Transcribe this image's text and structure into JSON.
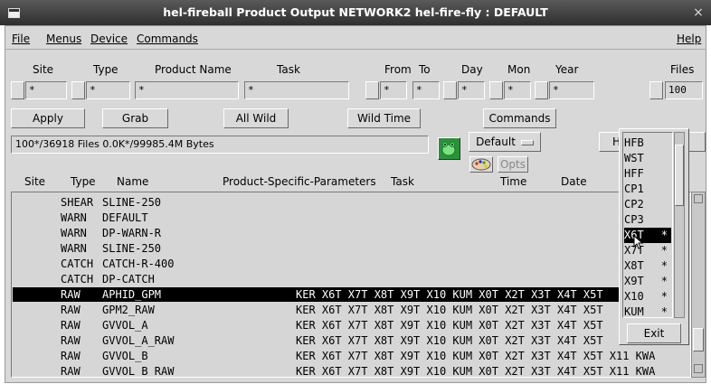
{
  "window": {
    "title": "hel-fireball   Product Output NETWORK2 hel-fire-fly : DEFAULT",
    "close_glyph": "×"
  },
  "menu": {
    "file": "File",
    "menus": "Menus",
    "device": "Device",
    "commands": "Commands",
    "help": "Help"
  },
  "filters": {
    "labels": {
      "site": "Site",
      "type": "Type",
      "product_name": "Product Name",
      "task": "Task",
      "from": "From",
      "to": "To",
      "day": "Day",
      "mon": "Mon",
      "year": "Year",
      "files": "Files"
    },
    "values": {
      "site": "*",
      "type": "*",
      "product_name": "*",
      "task": "*",
      "from": "*",
      "to": "*",
      "day": "*",
      "mon": "*",
      "year": "*",
      "files": "100"
    }
  },
  "buttons": {
    "apply": "Apply",
    "grab": "Grab",
    "all_wild": "All Wild",
    "wild_time": "Wild Time",
    "commands": "Commands",
    "default": "Default",
    "opts": "Opts",
    "he": "He",
    "exit": "Exit"
  },
  "status": "100*/36918 Files  0.0K*/99985.4M Bytes",
  "columns": {
    "site": "Site",
    "type": "Type",
    "name": "Name",
    "params": "Product-Specific-Parameters",
    "task": "Task",
    "time": "Time",
    "date": "Date"
  },
  "rows": [
    {
      "type": "SHEAR",
      "name": "SLINE-250",
      "params": ""
    },
    {
      "type": "WARN",
      "name": "DEFAULT",
      "params": ""
    },
    {
      "type": "WARN",
      "name": "DP-WARN-R",
      "params": ""
    },
    {
      "type": "WARN",
      "name": "SLINE-250",
      "params": ""
    },
    {
      "type": "CATCH",
      "name": "CATCH-R-400",
      "params": ""
    },
    {
      "type": "CATCH",
      "name": "DP-CATCH",
      "params": ""
    },
    {
      "type": "RAW",
      "name": "APHID_GPM",
      "params": "KER X6T X7T X8T X9T X10 KUM X0T X2T X3T X4T X5T",
      "selected": true
    },
    {
      "type": "RAW",
      "name": "GPM2_RAW",
      "params": "KER X6T X7T X8T X9T X10 KUM X0T X2T X3T X4T X5T"
    },
    {
      "type": "RAW",
      "name": "GVVOL_A",
      "params": "KER X6T X7T X8T X9T X10 KUM X0T X2T X3T X4T X5T"
    },
    {
      "type": "RAW",
      "name": "GVVOL_A_RAW",
      "params": "KER X6T X7T X8T X9T X10 KUM X0T X2T X3T X4T X5T"
    },
    {
      "type": "RAW",
      "name": "GVVOL_B",
      "params": "KER X6T X7T X8T X9T X10 KUM X0T X2T X3T X4T X5T X11 KWA"
    },
    {
      "type": "RAW",
      "name": "GVVOL_B_RAW",
      "params": "KER X6T X7T X8T X9T X10 KUM X0T X2T X3T X4T X5T X11 KWA"
    }
  ],
  "popup_items": [
    {
      "label": "HFB",
      "star": ""
    },
    {
      "label": "WST",
      "star": ""
    },
    {
      "label": "HFF",
      "star": ""
    },
    {
      "label": "CP1",
      "star": ""
    },
    {
      "label": "CP2",
      "star": ""
    },
    {
      "label": "CP3",
      "star": ""
    },
    {
      "label": "X6T",
      "star": "*",
      "selected": true
    },
    {
      "label": "X7T",
      "star": "*"
    },
    {
      "label": "X8T",
      "star": "*"
    },
    {
      "label": "X9T",
      "star": "*"
    },
    {
      "label": "X10",
      "star": "*"
    },
    {
      "label": "KUM",
      "star": "*"
    }
  ],
  "icons": {
    "app_icon": "green-frog-icon",
    "palette_icon": "palette-icon"
  }
}
